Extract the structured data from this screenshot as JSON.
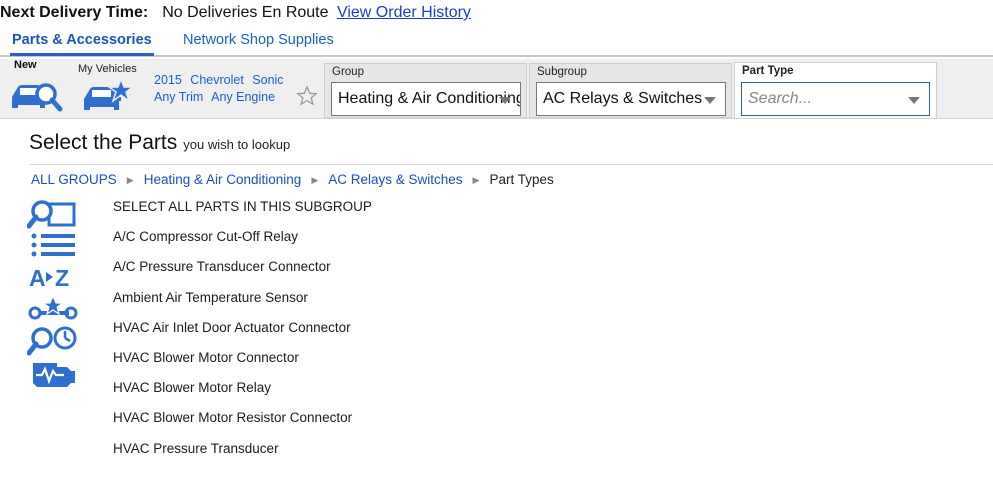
{
  "delivery": {
    "label": "Next Delivery Time:",
    "value": "No Deliveries En Route",
    "link": "View Order History"
  },
  "tabs": [
    {
      "label": "Parts & Accessories",
      "active": true
    },
    {
      "label": "Network Shop Supplies",
      "active": false
    }
  ],
  "toolbar": {
    "new_label": "New",
    "my_vehicles_label": "My Vehicles",
    "vehicle": {
      "year": "2015",
      "make": "Chevrolet",
      "model": "Sonic",
      "trim": "Any Trim",
      "engine": "Any Engine"
    },
    "group": {
      "caption": "Group",
      "value": "Heating & Air Conditioning"
    },
    "subgroup": {
      "caption": "Subgroup",
      "value": "AC Relays & Switches"
    },
    "part_type": {
      "caption": "Part Type",
      "placeholder": "Search..."
    }
  },
  "page": {
    "title": "Select the Parts",
    "subtitle": "you wish to lookup"
  },
  "breadcrumb": {
    "items": [
      "ALL GROUPS",
      "Heating & Air Conditioning",
      "AC Relays & Switches"
    ],
    "current": "Part Types"
  },
  "parts": [
    "SELECT ALL PARTS IN THIS SUBGROUP",
    "A/C Compressor Cut-Off Relay",
    "A/C Pressure Transducer Connector",
    "Ambient Air Temperature Sensor",
    "HVAC Air Inlet Door Actuator Connector",
    "HVAC Blower Motor Connector",
    "HVAC Blower Motor Relay",
    "HVAC Blower Motor Resistor Connector",
    "HVAC Pressure Transducer"
  ],
  "side_icons": [
    "search-panel-icon",
    "list-icon",
    "a-to-z-icon",
    "repair-tools-icon",
    "search-clock-icon",
    "engine-warning-icon"
  ],
  "colors": {
    "accent": "#1a5fc8",
    "icon": "#2f6fd0",
    "toolbar_bg": "#efefef"
  }
}
